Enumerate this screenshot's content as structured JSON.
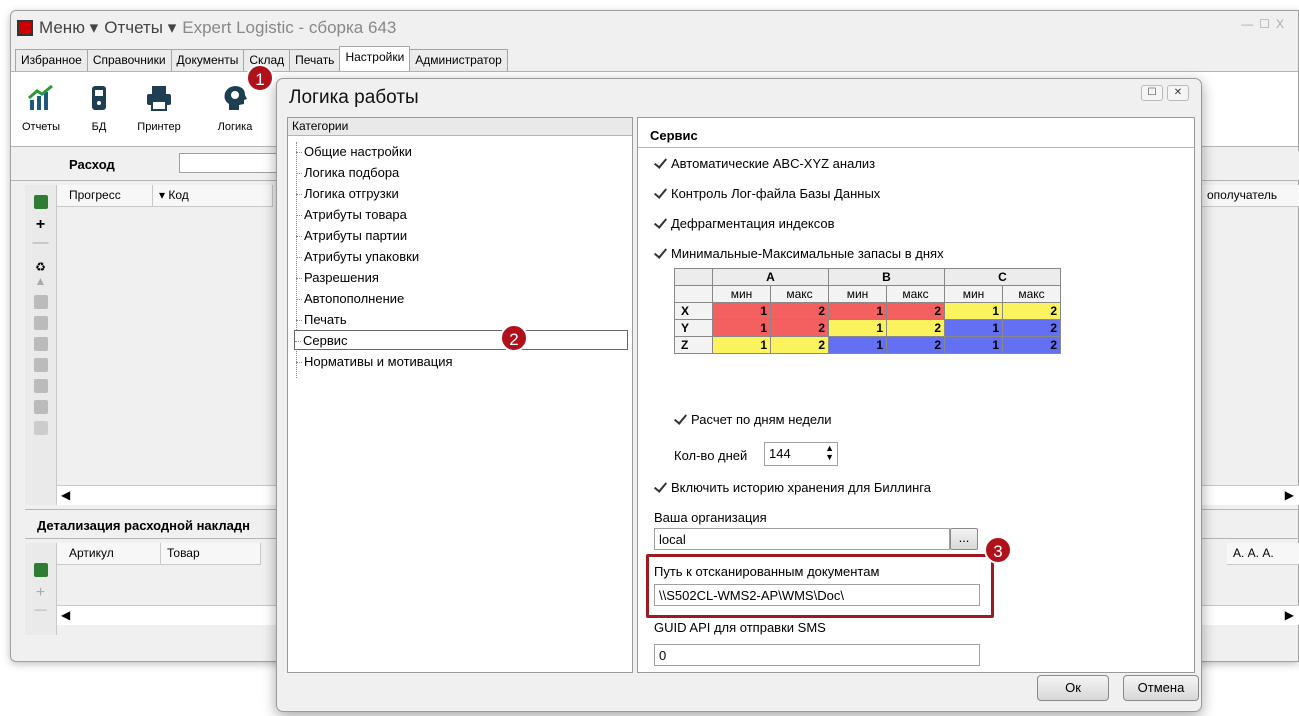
{
  "app": {
    "menu": "Меню",
    "reports_menu": "Отчеты",
    "title": "Expert Logistic - сборка 643"
  },
  "tabs": [
    "Избранное",
    "Справочники",
    "Документы",
    "Склад",
    "Печать",
    "Настройки",
    "Администратор"
  ],
  "toolbar": {
    "reports": "Отчеты",
    "db": "БД",
    "printer": "Принтер",
    "logic": "Логика"
  },
  "main": {
    "outgoing_title": "Расход",
    "col_progress": "Прогресс",
    "col_code": "Код",
    "col_recipient": "ополучатель",
    "detail_title": "Детализация расходной накладн",
    "col_article": "Артикул",
    "col_goods": "Товар",
    "col_a": "А.  А.  А."
  },
  "dialog": {
    "title": "Логика работы",
    "categories_header": "Категории",
    "categories": [
      "Общие настройки",
      "Логика подбора",
      "Логика отгрузки",
      "Атрибуты товара",
      "Атрибуты партии",
      "Атрибуты упаковки",
      "Разрешения",
      "Автопополнение",
      "Печать",
      "Сервис",
      "Нормативы и мотивация"
    ],
    "selected_category": "Сервис",
    "section_title": "Сервис",
    "checks": {
      "abc": "Автоматические ABC-XYZ анализ",
      "log": "Контроль Лог-файла Базы Данных",
      "defrag": "Дефрагментация индексов",
      "minmax": "Минимальные-Максимальные запасы в днях",
      "weekdays": "Расчет по дням недели",
      "billing": "Включить историю хранения для Биллинга"
    },
    "matrix": {
      "groups": [
        "A",
        "B",
        "C"
      ],
      "sub": [
        "мин",
        "макс"
      ],
      "rows": [
        {
          "label": "X",
          "vals": [
            "1",
            "2",
            "1",
            "2",
            "1",
            "2"
          ]
        },
        {
          "label": "Y",
          "vals": [
            "1",
            "2",
            "1",
            "2",
            "1",
            "2"
          ]
        },
        {
          "label": "Z",
          "vals": [
            "1",
            "2",
            "1",
            "2",
            "1",
            "2"
          ]
        }
      ]
    },
    "days_label": "Кол-во дней",
    "days_value": "144",
    "org_label": "Ваша организация",
    "org_value": "local",
    "org_btn": "...",
    "scan_label": "Путь к отсканированным документам",
    "scan_value": "\\\\S502CL-WMS2-AP\\WMS\\Doc\\",
    "guid_label": "GUID API для отправки SMS",
    "guid_value": "0",
    "ok": "Ок",
    "cancel": "Отмена"
  },
  "badges": [
    "1",
    "2",
    "3"
  ],
  "colors": {
    "red": "#f46060",
    "yellow": "#fbf35d",
    "blue": "#6470f4",
    "badge": "#b0121b"
  }
}
